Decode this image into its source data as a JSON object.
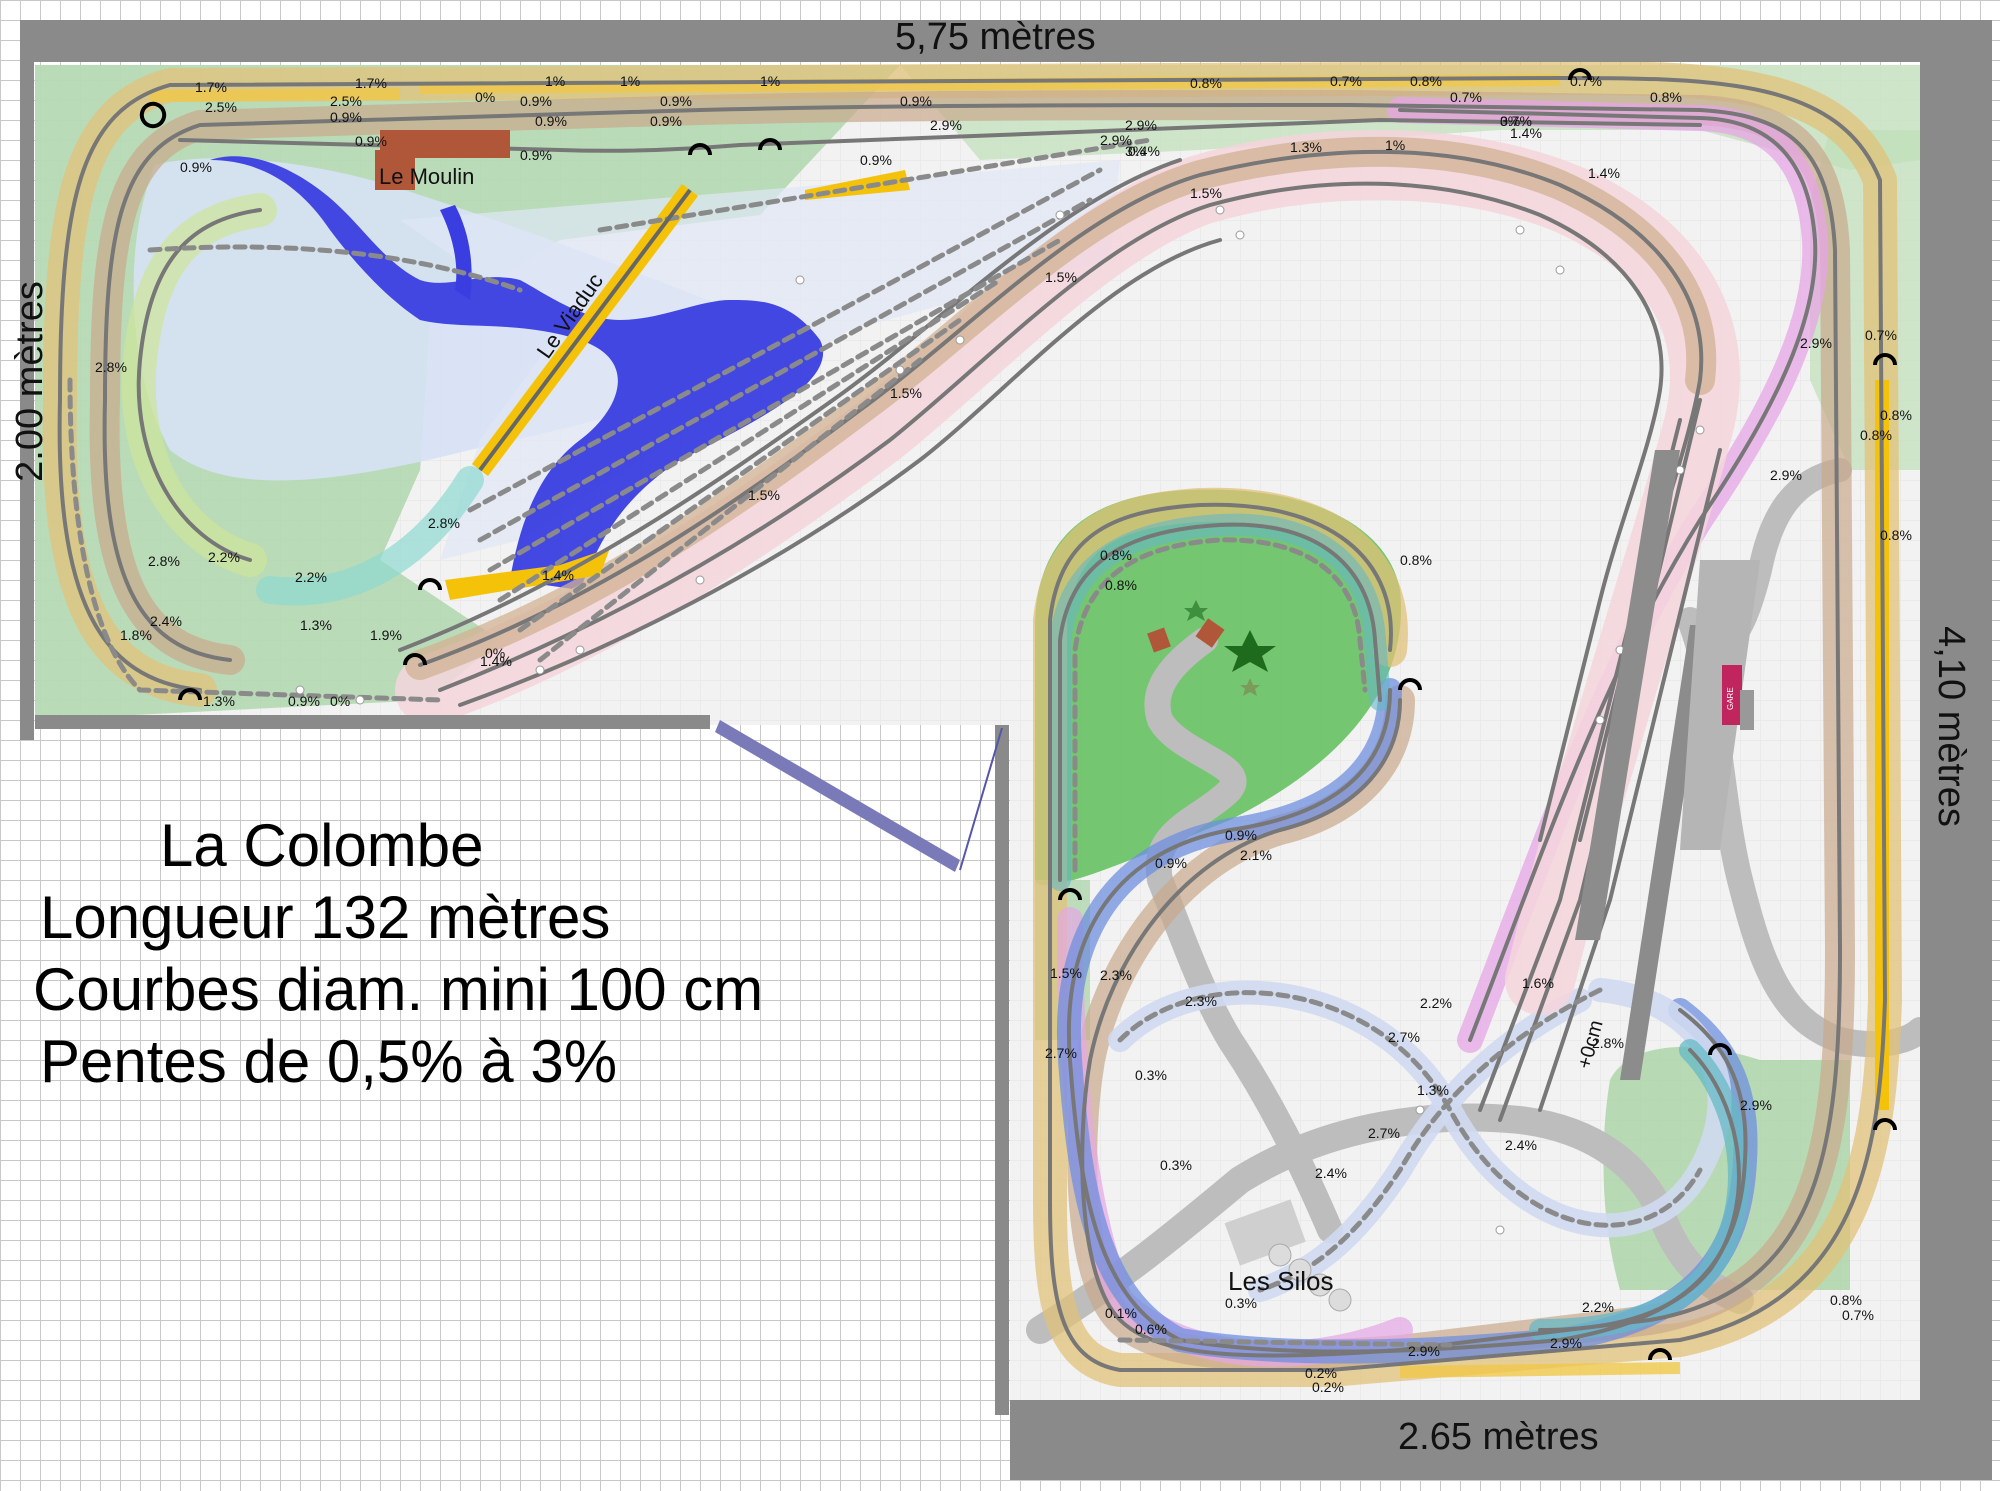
{
  "dimensions": {
    "top": "5,75 mètres",
    "left": "2.00 mètres",
    "right": "4,10 mètres",
    "bottom": "2.65 mètres"
  },
  "info": {
    "name": "La Colombe",
    "length": "Longueur 132 mètres",
    "curves": "Courbes diam. mini 100 cm",
    "slopes": "Pentes de 0,5% à 3%"
  },
  "places": {
    "moulin": "Le Moulin",
    "viaduc": "Le Viaduc",
    "silos": "Les Silos",
    "gare": "GARE",
    "height_mark": "+0cm"
  },
  "grade_labels": [
    "1.7%",
    "1.7%",
    "2.5%",
    "2.5%",
    "0.9%",
    "0.9%",
    "0.9%",
    "0.9%",
    "0.9%",
    "0%",
    "1%",
    "1%",
    "1%",
    "0.9%",
    "0.9%",
    "0.9%",
    "0.9%",
    "0.9%",
    "2.9%",
    "2.9%",
    "2.9%",
    "0.8%",
    "0.8%",
    "0.8%",
    "0.7%",
    "0.7%",
    "0.7%",
    "0.7%",
    "3%",
    "3%",
    "0.4%",
    "1%",
    "1.3%",
    "1.4%",
    "1.5%",
    "1.5%",
    "1.5%",
    "1.5%",
    "1.4%",
    "2.9%",
    "2.9%",
    "0.7%",
    "0.8%",
    "0.8%",
    "0.8%",
    "2.8%",
    "2.8%",
    "2.8%",
    "2.2%",
    "2.2%",
    "2.4%",
    "1.8%",
    "1.3%",
    "1.3%",
    "1.9%",
    "1.4%",
    "1.4%",
    "0%",
    "0%",
    "0.9%",
    "0.8%",
    "0.8%",
    "0.9%",
    "0.8%",
    "0.9%",
    "2.1%",
    "1.5%",
    "2.7%",
    "2.3%",
    "2.3%",
    "2.2%",
    "2.7%",
    "2.7%",
    "2.4%",
    "2.4%",
    "0.3%",
    "0.3%",
    "0.3%",
    "0.2%",
    "0.2%",
    "0.1%",
    "0.6%",
    "2.9%",
    "2.9%",
    "2.2%",
    "0.8%",
    "0.7%",
    "1.6%",
    "2.8%",
    "2.9%",
    "1.3%"
  ]
}
